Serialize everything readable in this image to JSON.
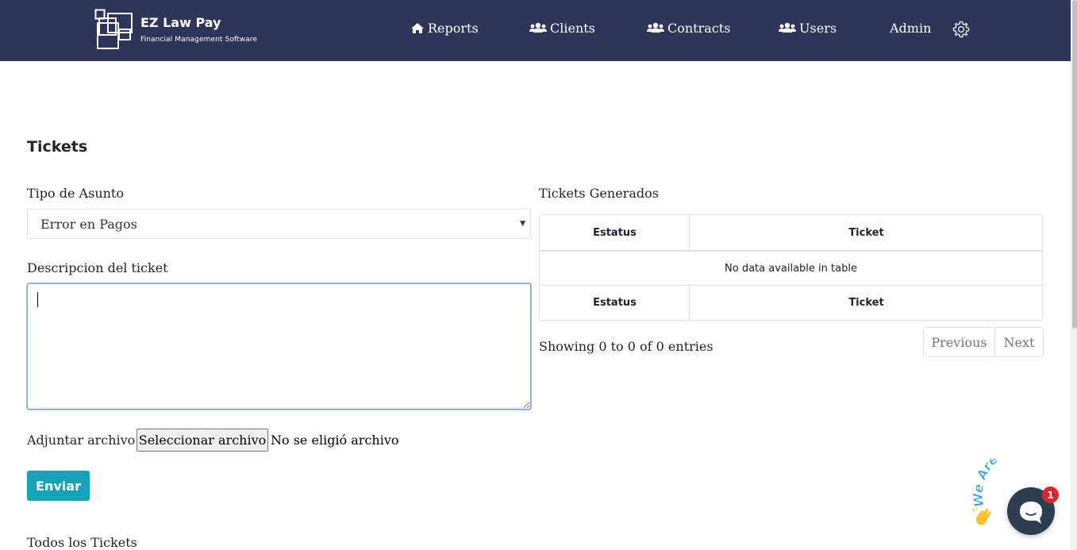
{
  "brand": {
    "name": "EZ Law Pay",
    "tagline": "Financial Management Software"
  },
  "nav": {
    "items": [
      {
        "label": "Reports",
        "icon": "home-icon"
      },
      {
        "label": "Clients",
        "icon": "users-icon"
      },
      {
        "label": "Contracts",
        "icon": "users-icon"
      },
      {
        "label": "Users",
        "icon": "users-icon"
      },
      {
        "label": "Admin",
        "icon": ""
      }
    ],
    "settings_icon": "gear-icon"
  },
  "colors": {
    "navbar": "#2e3559",
    "accent": "#17a2b8",
    "chat": "#2d3e50",
    "badge": "#e0252c",
    "we_are_here": "#3aa1e6"
  },
  "page": {
    "title": "Tickets"
  },
  "form": {
    "subject_label": "Tipo de Asunto",
    "subject_value": "Error en Pagos",
    "description_label": "Descripcion del ticket",
    "description_value": "",
    "attach_label": "Adjuntar archivo :",
    "attach_button": "Seleccionar archivo",
    "attach_status": "No se eligió archivo",
    "submit_label": "Enviar"
  },
  "generated": {
    "title": "Tickets Generados",
    "columns": [
      "Estatus",
      "Ticket"
    ],
    "empty_message": "No data available in table",
    "footer_columns": [
      "Estatus",
      "Ticket"
    ],
    "info": "Showing 0 to 0 of 0 entries",
    "previous_label": "Previous",
    "next_label": "Next"
  },
  "all_tickets_title": "Todos los Tickets",
  "chat": {
    "banner": "We Are Here!",
    "unread_count": "1"
  }
}
